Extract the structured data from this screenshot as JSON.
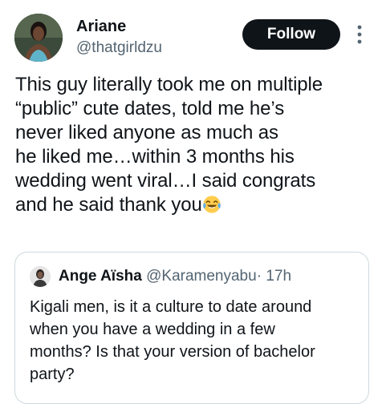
{
  "tweet": {
    "author": {
      "display_name": "Ariane",
      "handle": "@thatgirldzu",
      "avatar": "profile-photo"
    },
    "follow_label": "Follow",
    "more_icon": "more-vertical-icon",
    "text": "This guy literally took me on multiple\n“public” cute dates, told me he’s\nnever liked anyone as much as\nhe liked me…within 3 months his\nwedding went viral…I said congrats\nand he said thank you",
    "emoji": "face-with-tears-of-joy"
  },
  "quote": {
    "author": {
      "display_name": "Ange Aïsha",
      "handle": "@Karamenyabu",
      "avatar": "profile-photo"
    },
    "separator": "·",
    "time": "17h",
    "text": "Kigali men, is it a culture to date around\nwhen you have a wedding in  a few\nmonths? Is that your version of bachelor\nparty?"
  },
  "colors": {
    "text": "#0f1419",
    "secondary_text": "#536471",
    "follow_bg": "#0f1419",
    "border": "#cfd9de"
  }
}
